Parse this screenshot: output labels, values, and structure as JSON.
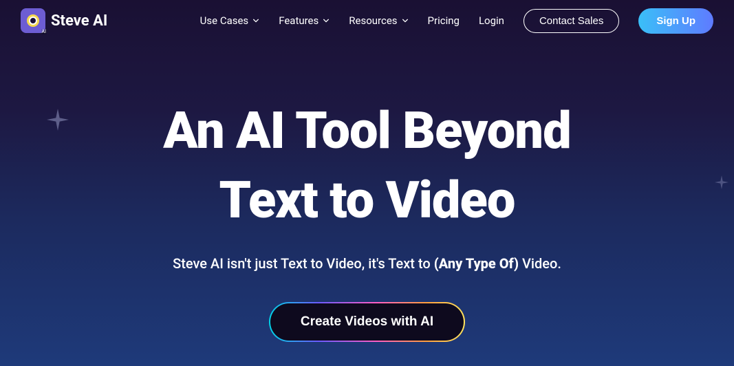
{
  "brand": {
    "name": "Steve AI",
    "badge": "AI"
  },
  "nav": {
    "use_cases": "Use Cases",
    "features": "Features",
    "resources": "Resources",
    "pricing": "Pricing",
    "login": "Login",
    "contact_sales": "Contact Sales",
    "sign_up": "Sign Up"
  },
  "hero": {
    "title_line1": "An AI Tool Beyond",
    "title_line2": "Text to Video",
    "sub_pre": "Steve AI isn't just Text to Video, it's Text to ",
    "sub_strong": "(Any Type Of)",
    "sub_post": " Video.",
    "cta": "Create Videos with AI"
  }
}
